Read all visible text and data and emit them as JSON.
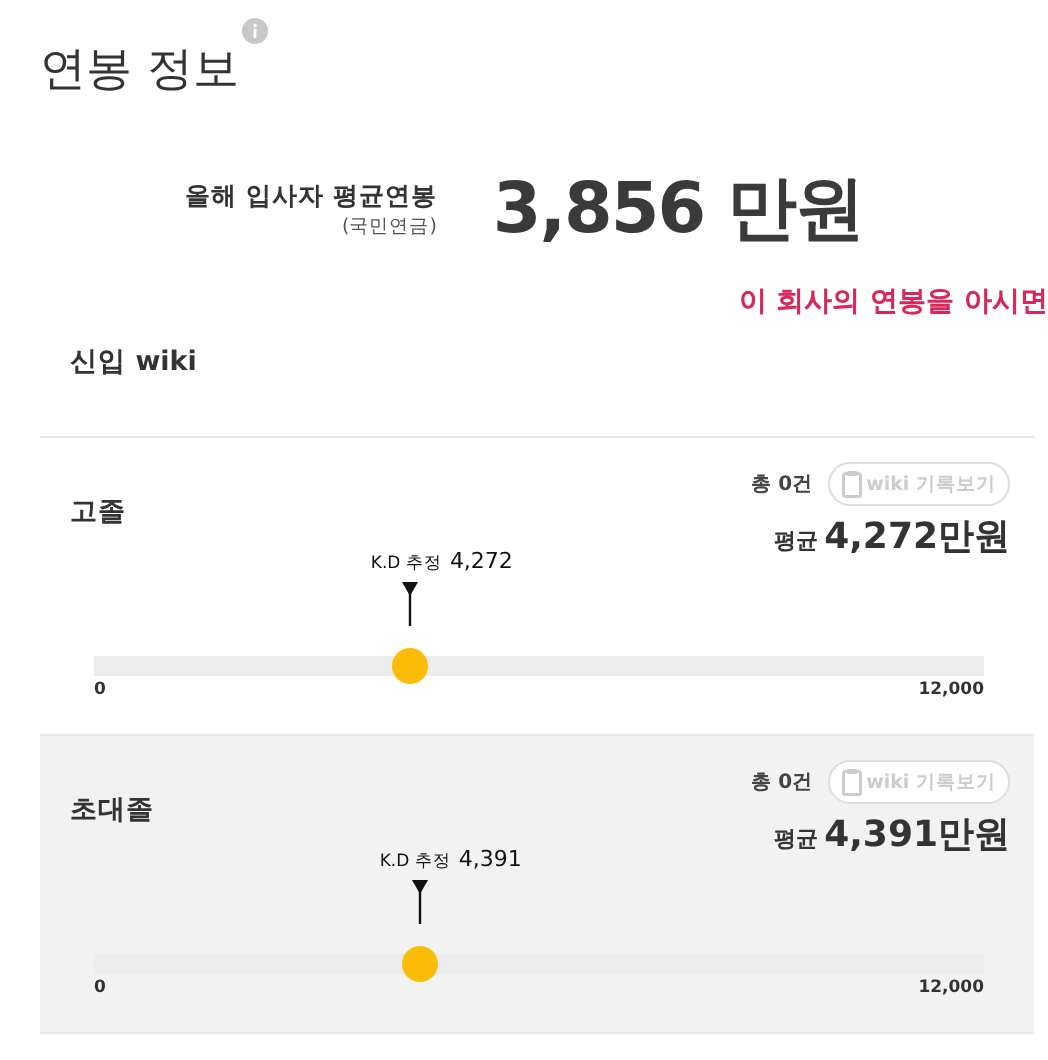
{
  "title": "연봉 정보",
  "summary": {
    "label": "올해 입사자 평균연봉",
    "sublabel": "(국민연금)",
    "value": "3,856 만원"
  },
  "notice": "이 회사의 연봉을 아시면",
  "section": {
    "title": "신입 wiki"
  },
  "groups": [
    {
      "name": "고졸",
      "count": "총 0건",
      "button": "wiki 기록보기",
      "avg_label": "평균",
      "avg_value": "4,272만원",
      "marker_label": "K.D 추정",
      "marker_value": "4,272",
      "level": 0.356,
      "min": "0",
      "max": "12,000",
      "shaded": false
    },
    {
      "name": "초대졸",
      "count": "총 0건",
      "button": "wiki 기록보기",
      "avg_label": "평균",
      "avg_value": "4,391만원",
      "marker_label": "K.D 추정",
      "marker_value": "4,391",
      "level": 0.366,
      "min": "0",
      "max": "12,000",
      "shaded": true
    }
  ]
}
